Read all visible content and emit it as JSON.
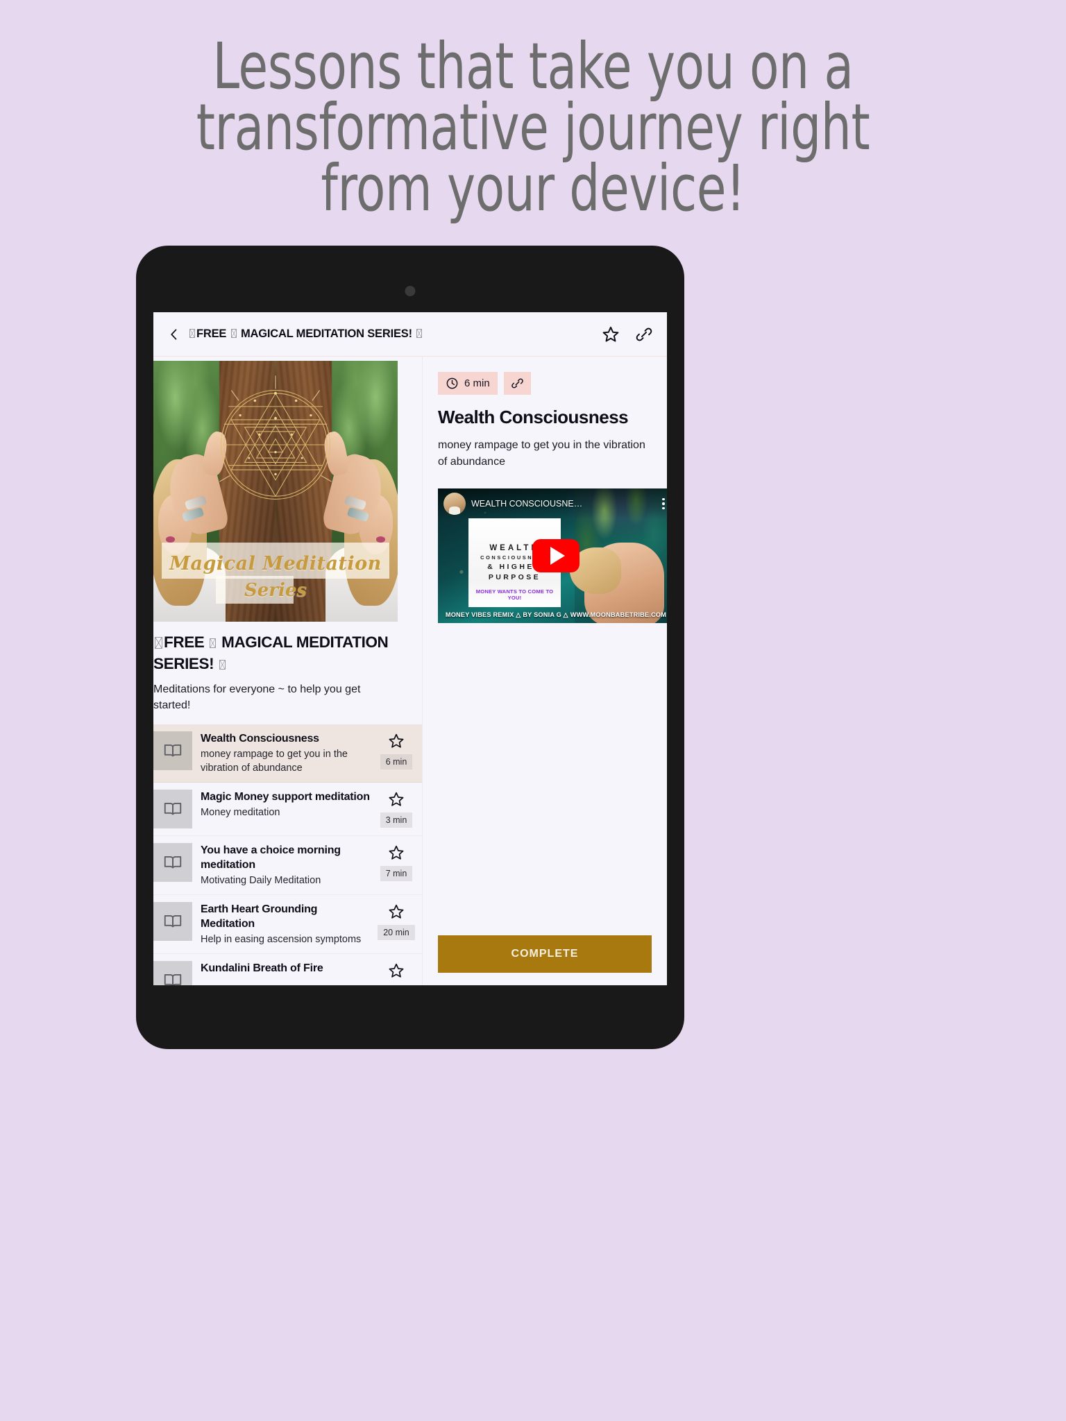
{
  "promo": {
    "headline_lines": [
      "Lessons that take you on a",
      "transformative journey right",
      "from your device!"
    ],
    "background_color": "#e6d9ef",
    "headline_color": "#6d6d6d"
  },
  "device": {
    "type": "tablet",
    "bezel_color": "#191919"
  },
  "app": {
    "header": {
      "title": "⬜FREE ⬜ MAGICAL MEDITATION SERIES! ⬜",
      "title_plain": "FREE  MAGICAL MEDITATION SERIES!",
      "back_icon": "chevron-left-icon",
      "actions": [
        {
          "icon": "star-outline-icon",
          "label": "Favorite"
        },
        {
          "icon": "link-icon",
          "label": "Share link"
        }
      ]
    },
    "course": {
      "hero": {
        "script_line1": "Magical Meditation",
        "script_line2": "Series",
        "overlay_color": "#c79a3e"
      },
      "title": "⬜FREE ⬜ MAGICAL MEDITATION SERIES! ⬜",
      "title_plain": "FREE  MAGICAL MEDITATION SERIES!",
      "subtitle": "Meditations for everyone ~ to help you get started!"
    },
    "lessons": [
      {
        "title": "Wealth Consciousness",
        "description": "money rampage to get you in the vibration of abundance",
        "duration": "6 min",
        "icon": "book-icon",
        "star": "star-outline-icon",
        "active": true
      },
      {
        "title": "Magic Money support meditation",
        "description": "Money meditation",
        "duration": "3 min",
        "icon": "book-icon",
        "star": "star-outline-icon",
        "active": false
      },
      {
        "title": "You have a choice morning meditation",
        "description": "Motivating Daily Meditation",
        "duration": "7 min",
        "icon": "book-icon",
        "star": "star-outline-icon",
        "active": false
      },
      {
        "title": "Earth Heart Grounding Meditation",
        "description": "Help in easing ascension symptoms",
        "duration": "20 min",
        "icon": "book-icon",
        "star": "star-outline-icon",
        "active": false
      },
      {
        "title": "Kundalini Breath of Fire",
        "description": "",
        "duration": "",
        "icon": "book-icon",
        "star": "star-outline-icon",
        "active": false
      }
    ],
    "detail": {
      "duration_badge": "6 min",
      "duration_icon": "clock-icon",
      "link_icon": "link-icon",
      "badge_color": "#f7d6d2",
      "title": "Wealth Consciousness",
      "summary": "money rampage to get you in the vibration of abundance",
      "video": {
        "provider": "youtube",
        "title": "WEALTH CONSCIOUSNE…",
        "play_icon": "youtube-play-icon",
        "play_color": "#ff0000",
        "menu_icon": "kebab-menu-icon",
        "avatar": "channel-avatar",
        "card_line1": "WEALTH",
        "card_line2": "CONSCIOUSNESS",
        "card_line3": "& HIGHER",
        "card_line4": "PURPOSE",
        "card_tagline": "MONEY WANTS TO COME TO YOU!",
        "footer": "MONEY VIBES REMIX △ BY SONIA G △ WWW.MOONBABETRIBE.COM"
      },
      "complete_label": "COMPLETE",
      "complete_color": "#a8790f"
    }
  }
}
